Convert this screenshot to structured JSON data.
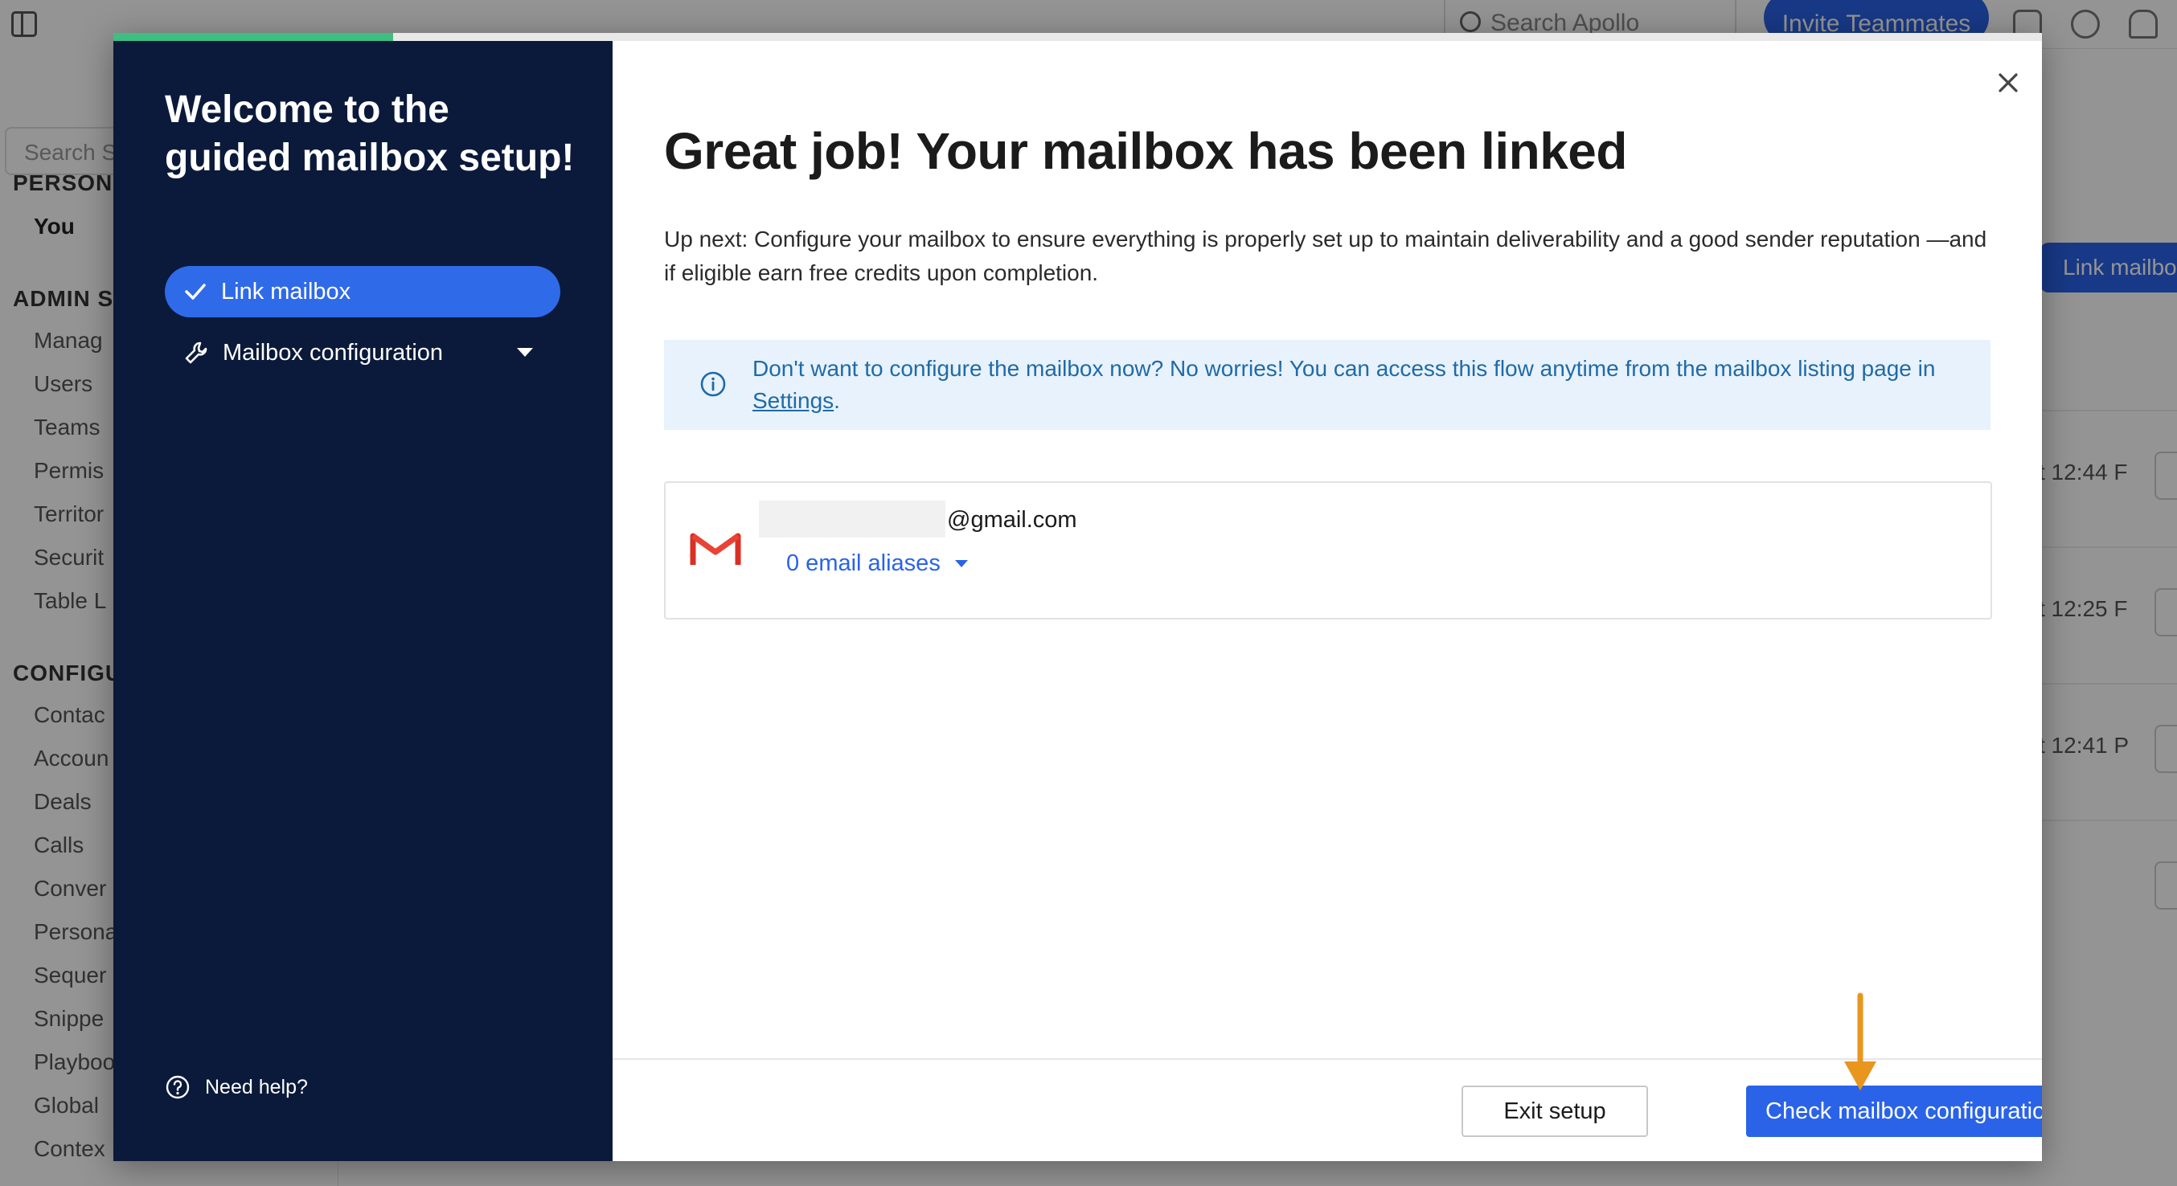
{
  "background": {
    "search_placeholder": "Search Apollo",
    "invite_button": "Invite Teammates",
    "sidebar_search": "Search S",
    "sections": [
      {
        "title": "PERSONA",
        "items": [
          "You"
        ]
      },
      {
        "title": "ADMIN S",
        "items": [
          "Manag",
          "Users",
          "Teams",
          "Permis",
          "Territor",
          "Securit",
          "Table L"
        ]
      },
      {
        "title": "CONFIGU",
        "items": [
          "Contac",
          "Accoun",
          "Deals",
          "Calls",
          "Conver",
          "Persona",
          "Sequer",
          "Snippe",
          "Playboo",
          "Global",
          "Contex"
        ]
      }
    ],
    "right_button": "Link mailbo",
    "row_times": [
      "t 12:44 F",
      "t 12:25 F",
      "t 12:41 P"
    ]
  },
  "modal": {
    "progress_fraction": 0.145,
    "left": {
      "title": "Welcome to the guided mailbox setup!",
      "steps": [
        {
          "label": "Link mailbox",
          "state": "completed",
          "icon": "check-icon"
        },
        {
          "label": "Mailbox configuration",
          "state": "pending",
          "icon": "wrench-icon"
        }
      ],
      "help": "Need help?"
    },
    "right": {
      "headline": "Great job! Your mailbox has been linked",
      "subtext": "Up next: Configure your mailbox to ensure everything is properly set up to maintain deliverability and a good sender reputation —and if eligible earn free credits upon completion.",
      "info_text_before": "Don't want to configure the mailbox now? No worries! You can access this flow anytime from the mailbox listing page in ",
      "info_link": "Settings",
      "info_text_after": ".",
      "account": {
        "email_domain": "@gmail.com",
        "aliases": "0 email aliases"
      },
      "exit_button": "Exit setup",
      "primary_button": "Check mailbox configuration"
    }
  },
  "colors": {
    "navy": "#0b1a3a",
    "primary_blue": "#2a63e8",
    "progress_green": "#3dbe82",
    "info_bg": "#e8f2fc",
    "annotation_arrow": "#e8961e"
  }
}
